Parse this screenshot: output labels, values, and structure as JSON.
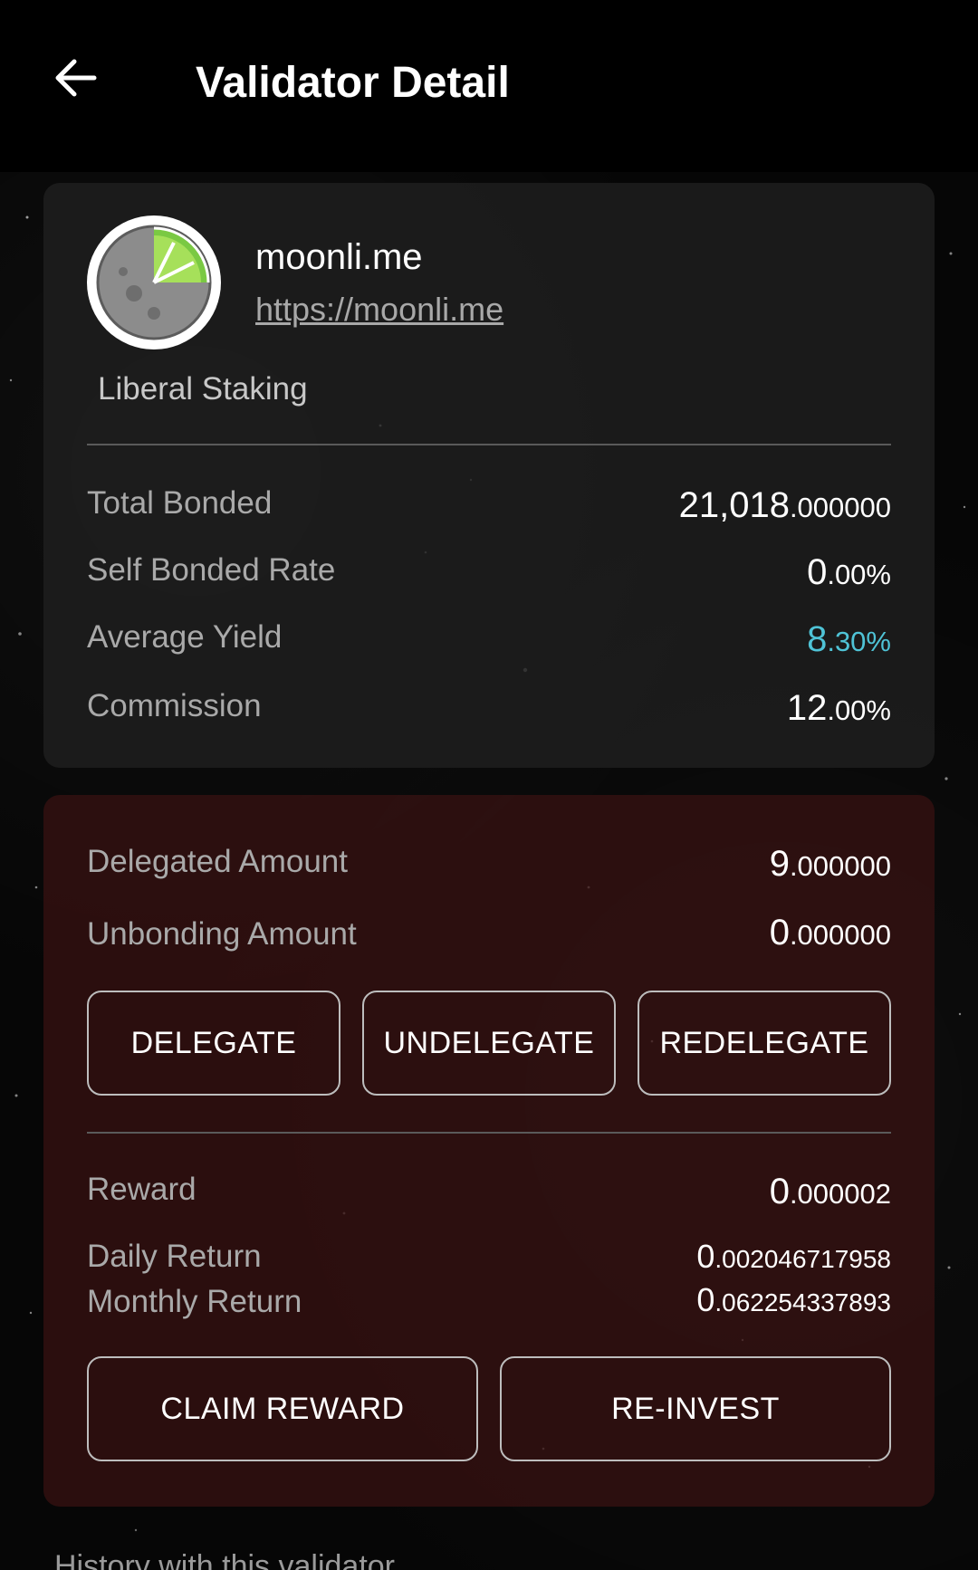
{
  "header": {
    "title": "Validator Detail",
    "back_icon": "arrow-left-icon"
  },
  "validator": {
    "moniker": "moonli.me",
    "website": "https://moonli.me",
    "description": "Liberal Staking",
    "avatar_icon": "moonlime-logo",
    "stats": {
      "total_bonded_label": "Total Bonded",
      "total_bonded_int": "21,018",
      "total_bonded_dec": ".000000",
      "self_bonded_label": "Self Bonded Rate",
      "self_bonded_int": "0",
      "self_bonded_dec": ".00%",
      "avg_yield_label": "Average Yield",
      "avg_yield_int": "8",
      "avg_yield_dec": ".30%",
      "commission_label": "Commission",
      "commission_int": "12",
      "commission_dec": ".00%"
    }
  },
  "delegation": {
    "delegated_label": "Delegated Amount",
    "delegated_int": "9",
    "delegated_dec": ".000000",
    "unbonding_label": "Unbonding Amount",
    "unbonding_int": "0",
    "unbonding_dec": ".000000",
    "buttons": {
      "delegate": "DELEGATE",
      "undelegate": "UNDELEGATE",
      "redelegate": "REDELEGATE"
    },
    "reward_label": "Reward",
    "reward_int": "0",
    "reward_dec": ".000002",
    "daily_label": "Daily Return",
    "daily_int": "0",
    "daily_dec": ".002046717958",
    "monthly_label": "Monthly Return",
    "monthly_int": "0",
    "monthly_dec": ".062254337893",
    "claim_button": "CLAIM REWARD",
    "reinvest_button": "RE-INVEST"
  },
  "history": {
    "label": "History with this validator"
  },
  "colors": {
    "background": "#060606",
    "accent_teal": "#4fc3d6",
    "delegation_card": "#3a1212",
    "validator_card": "#202020"
  }
}
